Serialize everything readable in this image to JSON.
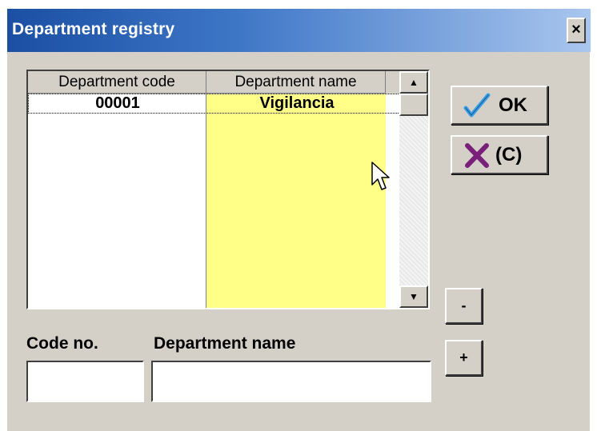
{
  "window": {
    "title": "Department registry",
    "close_label": "×"
  },
  "grid": {
    "columns": [
      "Department code",
      "Department name"
    ],
    "rows": [
      {
        "code": "00001",
        "name": "Vigilancia"
      }
    ],
    "scroll_up_label": "▲",
    "scroll_down_label": "▼"
  },
  "buttons": {
    "ok_label": "OK",
    "cancel_label": "(C)",
    "minus_label": "-",
    "plus_label": "+"
  },
  "form": {
    "code_label": "Code no.",
    "name_label": "Department name",
    "code_value": "",
    "name_value": ""
  },
  "icons": {
    "ok": "checkmark-icon",
    "cancel": "x-icon",
    "pointer": "mouse-pointer-icon"
  },
  "colors": {
    "title_gradient_start": "#1a4fa3",
    "title_gradient_end": "#a9c6ee",
    "name_column_bg": "#ffff88",
    "check_color": "#3aa0e6",
    "x_color": "#7a1f7a",
    "face": "#d4d0c8"
  }
}
